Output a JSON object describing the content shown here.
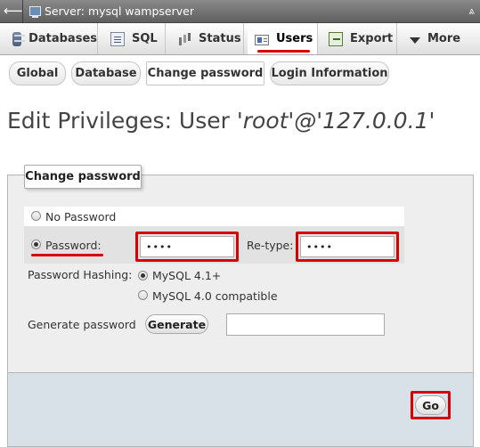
{
  "server_bar": {
    "back_symbol": "⟵",
    "title": "Server: mysql wampserver",
    "collapse_symbol": "⩓"
  },
  "tabs": [
    {
      "label": "Databases",
      "icon": "database-icon"
    },
    {
      "label": "SQL",
      "icon": "sql-icon"
    },
    {
      "label": "Status",
      "icon": "status-icon"
    },
    {
      "label": "Users",
      "icon": "users-icon",
      "active": true
    },
    {
      "label": "Export",
      "icon": "export-icon"
    },
    {
      "label": "More",
      "icon": "chevron-down-icon"
    }
  ],
  "subtabs": [
    {
      "label": "Global"
    },
    {
      "label": "Database"
    },
    {
      "label": "Change password",
      "active": true
    },
    {
      "label": "Login Information"
    }
  ],
  "page_title": {
    "prefix": "Edit Privileges: User ",
    "user": "'root'@'127.0.0.1'"
  },
  "form": {
    "legend": "Change password",
    "no_password_label": "No Password",
    "password_label": "Password:",
    "password_value": "••••",
    "retype_label": "Re-type:",
    "retype_value": "••••",
    "hashing_label": "Password Hashing:",
    "hashing_options": [
      "MySQL 4.1+",
      "MySQL 4.0 compatible"
    ],
    "generate_label": "Generate password",
    "generate_button": "Generate",
    "generated_value": "",
    "go_button": "Go"
  },
  "colors": {
    "highlight": "#d80000",
    "link": "#235a81",
    "panel": "#eeeeee",
    "footer": "#d9e1e8"
  }
}
